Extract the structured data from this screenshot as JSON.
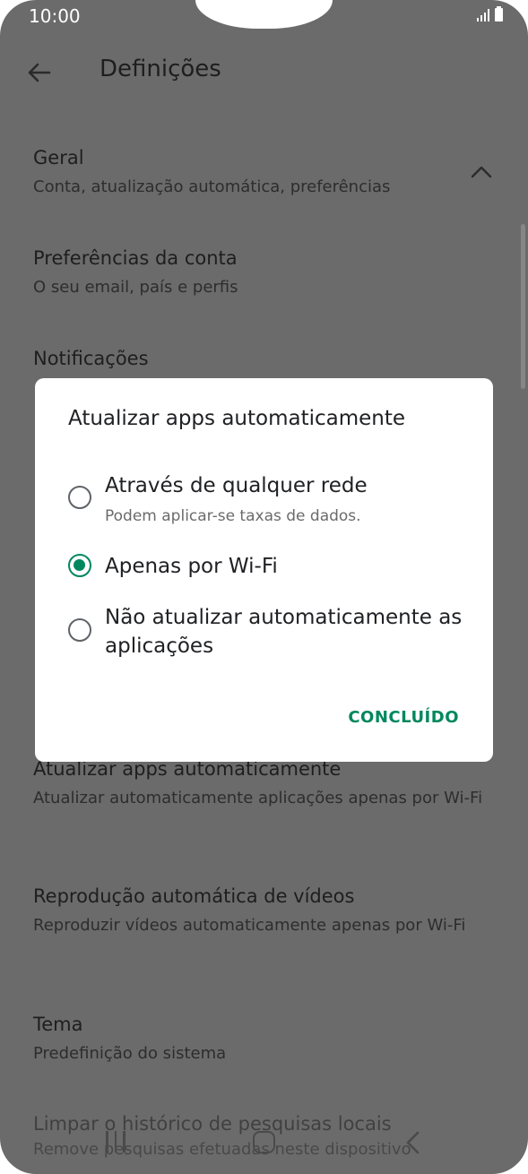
{
  "status_bar": {
    "time": "10:00"
  },
  "app_bar": {
    "title": "Definições"
  },
  "settings": {
    "geral": {
      "title": "Geral",
      "subtitle": "Conta, atualização automática, preferências"
    },
    "conta": {
      "title": "Preferências da conta",
      "subtitle": "O seu email, país e perfis"
    },
    "notificacoes": {
      "title": "Notificações"
    },
    "auto_update": {
      "title": "Atualizar apps automaticamente",
      "subtitle": "Atualizar automaticamente aplicações apenas por Wi-Fi"
    },
    "video": {
      "title": "Reprodução automática de vídeos",
      "subtitle": "Reproduzir vídeos automaticamente apenas por Wi-Fi"
    },
    "tema": {
      "title": "Tema",
      "subtitle": "Predefinição do sistema"
    },
    "historico": {
      "title": "Limpar o histórico de pesquisas locais",
      "subtitle": "Remove pesquisas efetuadas neste dispositivo"
    }
  },
  "dialog": {
    "title": "Atualizar apps automaticamente",
    "options": [
      {
        "label": "Através de qualquer rede",
        "sublabel": "Podem aplicar-se taxas de dados.",
        "selected": false
      },
      {
        "label": "Apenas por Wi-Fi",
        "selected": true
      },
      {
        "label": "Não atualizar automaticamente as aplicações",
        "selected": false
      }
    ],
    "done_label": "CONCLUÍDO"
  },
  "colors": {
    "accent": "#01875f",
    "scrim_background": "#6b6b6b",
    "dialog_background": "#ffffff"
  }
}
